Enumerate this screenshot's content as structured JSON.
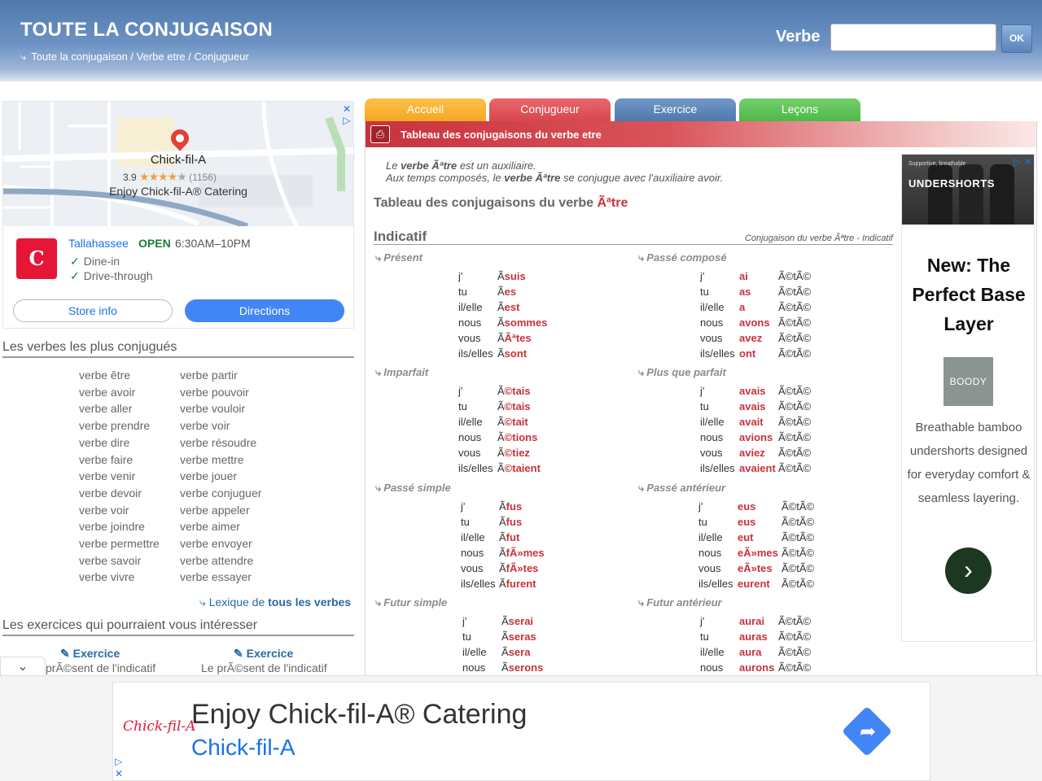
{
  "header": {
    "title": "TOUTE LA CONJUGAISON",
    "breadcrumb": "Toute la conjugaison / Verbe etre / Conjugueur",
    "verbe_label": "Verbe",
    "ok_label": "OK"
  },
  "map_ad": {
    "name": "Chick-fil-A",
    "rating": "3.9",
    "stars": "★★★★",
    "star_empty": "★",
    "count": "(1156)",
    "tagline": "Enjoy Chick-fil-A® Catering",
    "city": "Tallahassee",
    "status": "OPEN",
    "hours": "6:30AM–10PM",
    "feature1": "Dine-in",
    "feature2": "Drive-through",
    "store_info": "Store info",
    "directions": "Directions"
  },
  "left": {
    "popular_title": "Les verbes les plus conjugués",
    "col1": [
      "verbe être",
      "verbe avoir",
      "verbe aller",
      "verbe prendre",
      "verbe dire",
      "verbe faire",
      "verbe venir",
      "verbe devoir",
      "verbe voir",
      "verbe joindre",
      "verbe permettre",
      "verbe savoir",
      "verbe vivre"
    ],
    "col2": [
      "verbe partir",
      "verbe pouvoir",
      "verbe vouloir",
      "verbe voir",
      "verbe résoudre",
      "verbe mettre",
      "verbe jouer",
      "verbe conjuguer",
      "verbe appeler",
      "verbe aimer",
      "verbe envoyer",
      "verbe attendre",
      "verbe essayer"
    ],
    "lexique_prefix": "Lexique de ",
    "lexique_bold": "tous les verbes",
    "exercises_title": "Les exercices qui pourraient vous intéresser",
    "ex1": "Exercice",
    "ex1_sub": "prÃ©sent de l'indicatif",
    "ex2": "Exercice",
    "ex2_sub": "Le prÃ©sent de l'indicatif"
  },
  "tabs": [
    "Accueil",
    "Conjugueur",
    "Exercice",
    "Leçons"
  ],
  "panel": {
    "title": "Tableau des conjugaisons du verbe etre",
    "intro1_a": "Le ",
    "intro1_b": "verbe Ãªtre",
    "intro1_c": " est un auxiliaire.",
    "intro2_a": "Aux temps composés, le ",
    "intro2_b": "verbe Ãªtre",
    "intro2_c": " se conjugue avec l'auxiliaire avoir.",
    "table_title": "Tableau des conjugaisons du verbe ",
    "table_verb": "Ãªtre",
    "mood": "Indicatif",
    "mood_right": "Conjugaison du verbe Ãªtre - Indicatif"
  },
  "tenses": {
    "present": {
      "name": "Présent",
      "rows": [
        [
          "j'",
          "Ã",
          "suis"
        ],
        [
          "tu",
          "Ã",
          "es"
        ],
        [
          "il/elle",
          "Ã",
          "est"
        ],
        [
          "nous",
          "Ã",
          "sommes"
        ],
        [
          "vous",
          "Ã",
          "Ãªtes"
        ],
        [
          "ils/elles",
          "Ã",
          "sont"
        ]
      ]
    },
    "imparfait": {
      "name": "Imparfait",
      "rows": [
        [
          "j'",
          "Ã",
          "©tais"
        ],
        [
          "tu",
          "Ã",
          "©tais"
        ],
        [
          "il/elle",
          "Ã",
          "©tait"
        ],
        [
          "nous",
          "Ã",
          "©tions"
        ],
        [
          "vous",
          "Ã",
          "©tiez"
        ],
        [
          "ils/elles",
          "Ã",
          "©taient"
        ]
      ]
    },
    "passe_simple": {
      "name": "Passé simple",
      "rows": [
        [
          "j'",
          "Ã",
          "fus"
        ],
        [
          "tu",
          "Ã",
          "fus"
        ],
        [
          "il/elle",
          "Ã",
          "fut"
        ],
        [
          "nous",
          "Ã",
          "fÃ»mes"
        ],
        [
          "vous",
          "Ã",
          "fÃ»tes"
        ],
        [
          "ils/elles",
          "Ã",
          "furent"
        ]
      ]
    },
    "futur_simple": {
      "name": "Futur simple",
      "rows": [
        [
          "j'",
          "Ã",
          "serai"
        ],
        [
          "tu",
          "Ã",
          "seras"
        ],
        [
          "il/elle",
          "Ã",
          "sera"
        ],
        [
          "nous",
          "Ã",
          "serons"
        ]
      ]
    },
    "passe_compose": {
      "name": "Passé composé",
      "rows": [
        [
          "j'",
          "ai",
          "Ã©tÃ©"
        ],
        [
          "tu",
          "as",
          "Ã©tÃ©"
        ],
        [
          "il/elle",
          "a",
          "Ã©tÃ©"
        ],
        [
          "nous",
          "avons",
          "Ã©tÃ©"
        ],
        [
          "vous",
          "avez",
          "Ã©tÃ©"
        ],
        [
          "ils/elles",
          "ont",
          "Ã©tÃ©"
        ]
      ]
    },
    "plus_que_parfait": {
      "name": "Plus que parfait",
      "rows": [
        [
          "j'",
          "avais",
          "Ã©tÃ©"
        ],
        [
          "tu",
          "avais",
          "Ã©tÃ©"
        ],
        [
          "il/elle",
          "avait",
          "Ã©tÃ©"
        ],
        [
          "nous",
          "avions",
          "Ã©tÃ©"
        ],
        [
          "vous",
          "aviez",
          "Ã©tÃ©"
        ],
        [
          "ils/elles",
          "avaient",
          "Ã©tÃ©"
        ]
      ]
    },
    "passe_anterieur": {
      "name": "Passé antérieur",
      "rows": [
        [
          "j'",
          "eus",
          "Ã©tÃ©"
        ],
        [
          "tu",
          "eus",
          "Ã©tÃ©"
        ],
        [
          "il/elle",
          "eut",
          "Ã©tÃ©"
        ],
        [
          "nous",
          "eÃ»mes",
          "Ã©tÃ©"
        ],
        [
          "vous",
          "eÃ»tes",
          "Ã©tÃ©"
        ],
        [
          "ils/elles",
          "eurent",
          "Ã©tÃ©"
        ]
      ]
    },
    "futur_anterieur": {
      "name": "Futur antérieur",
      "rows": [
        [
          "j'",
          "aurai",
          "Ã©tÃ©"
        ],
        [
          "tu",
          "auras",
          "Ã©tÃ©"
        ],
        [
          "il/elle",
          "aura",
          "Ã©tÃ©"
        ],
        [
          "nous",
          "aurons",
          "Ã©tÃ©"
        ]
      ]
    }
  },
  "right_ad": {
    "image_text": "UNDERSHORTS",
    "image_small": "Supportive, breathable",
    "headline": "New: The Perfect Base Layer",
    "brand": "BOODY",
    "description": "Breathable bamboo undershorts designed for everyday comfort & seamless layering."
  },
  "bottom_ad": {
    "logo": "Chick-fil-A",
    "title": "Enjoy Chick-fil-A® Catering",
    "subtitle": "Chick-fil-A"
  },
  "colors": {
    "accueil": "#f5a623",
    "conjugueur": "#d9464c",
    "exercice": "#4f79ac",
    "lecons": "#4db848",
    "accent_red": "#c8323c",
    "link_blue": "#2a68a8"
  }
}
